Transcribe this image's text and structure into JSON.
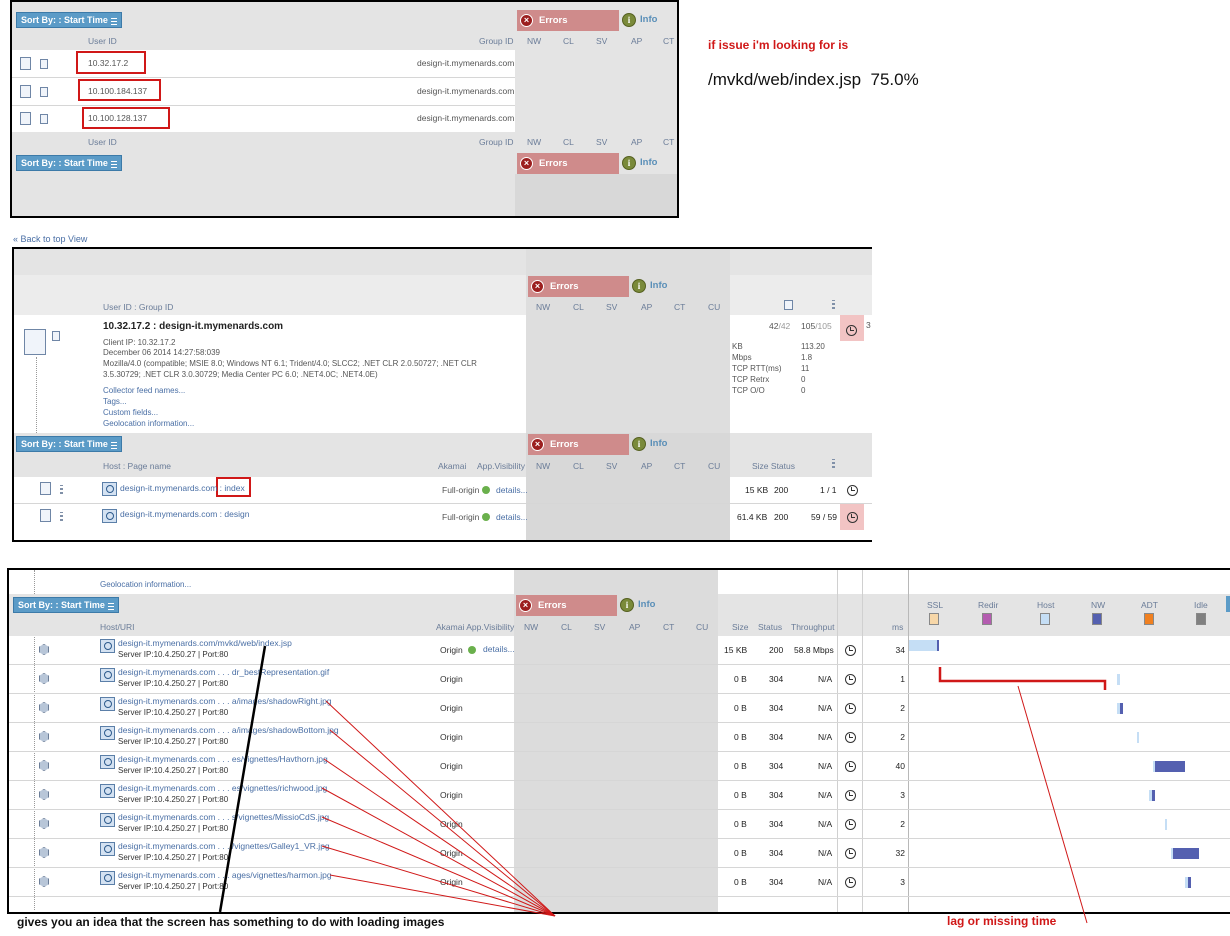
{
  "annotations": {
    "issue_title": "if issue i'm looking for is",
    "issue_value": "/mvkd/web/index.jsp  75.0%",
    "images_note": "gives you an idea that the screen has something to do with loading images",
    "lag_note": "lag or missing time"
  },
  "common": {
    "sort_by": "Sort By: : Start Time",
    "errors": "Errors",
    "info": "Info",
    "nw": "NW",
    "cl": "CL",
    "sv": "SV",
    "ap": "AP",
    "ct": "CT",
    "cu": "CU",
    "back_link": "« Back to top View"
  },
  "panel1": {
    "col_user_id": "User ID",
    "col_group_id": "Group ID",
    "rows": [
      {
        "user_id": "10.32.17.2",
        "group_id": "design-it.mymenards.com"
      },
      {
        "user_id": "10.100.184.137",
        "group_id": "design-it.mymenards.com"
      },
      {
        "user_id": "10.100.128.137",
        "group_id": "design-it.mymenards.com"
      }
    ]
  },
  "panel2": {
    "col_user_group": "User ID : Group ID",
    "title": "10.32.17.2 : design-it.mymenards.com",
    "client_ip": "Client IP: 10.32.17.2",
    "date": "December 06 2014 14:27:58:039",
    "agent1": "Mozilla/4.0 (compatible; MSIE 8.0; Windows NT 6.1; Trident/4.0; SLCC2; .NET CLR 2.0.50727; .NET CLR",
    "agent2": "3.5.30729; .NET CLR 3.0.30729; Media Center PC 6.0; .NET4.0C; .NET4.0E)",
    "links": [
      "Collector feed names...",
      "Tags...",
      "Custom fields...",
      "Geolocation information..."
    ],
    "count1": "42",
    "count1_total": "/42",
    "count2": "105",
    "count2_total": "/105",
    "three": "3",
    "stats": [
      {
        "label": "KB",
        "value": "113.20"
      },
      {
        "label": "Mbps",
        "value": "1.8"
      },
      {
        "label": "TCP RTT(ms)",
        "value": "11"
      },
      {
        "label": "TCP Retrx",
        "value": "0"
      },
      {
        "label": "TCP O/O",
        "value": "0"
      }
    ],
    "col_host_page": "Host : Page name",
    "col_akamai": "Akamai",
    "col_appvis": "App.Visibility",
    "col_size_status": "Size Status",
    "pages": [
      {
        "host": "design-it.mymenards.com",
        "page": " : index",
        "akamai": "Full-origin",
        "details": "details...",
        "size": "15 KB",
        "status": "200",
        "count": "1 / 1"
      },
      {
        "host": "design-it.mymenards.com : design",
        "page": "",
        "akamai": "Full-origin",
        "details": "details...",
        "size": "61.4 KB",
        "status": "200",
        "count": "59 / 59"
      }
    ]
  },
  "panel3": {
    "geo_link": "Geolocation information...",
    "col_host_uri": "Host/URI",
    "col_akamai_vis": "Akamai App.Visibility",
    "col_size": "Size",
    "col_status": "Status",
    "col_throughput": "Throughput",
    "col_ms": "ms",
    "legend": [
      {
        "label": "SSL",
        "color": "#f7d7a8"
      },
      {
        "label": "Redir",
        "color": "#b45cb0"
      },
      {
        "label": "Host",
        "color": "#c5def5"
      },
      {
        "label": "NW",
        "color": "#5460b0"
      },
      {
        "label": "ADT",
        "color": "#f08020"
      },
      {
        "label": "Idle",
        "color": "#808080"
      }
    ],
    "rows": [
      {
        "uri": "design-it.mymenards.com/mvkd/web/index.jsp",
        "server": "Server IP:10.4.250.27 | Port:80",
        "akamai": "Origin",
        "details": "details...",
        "size": "15 KB",
        "status": "200",
        "throughput": "58.8 Mbps",
        "ms": "34"
      },
      {
        "uri": "design-it.mymenards.com . . . dr_bestRepresentation.gif",
        "server": "Server IP:10.4.250.27 | Port:80",
        "akamai": "Origin",
        "details": "",
        "size": "0 B",
        "status": "304",
        "throughput": "N/A",
        "ms": "1"
      },
      {
        "uri": "design-it.mymenards.com . . . a/images/shadowRight.jpg",
        "server": "Server IP:10.4.250.27 | Port:80",
        "akamai": "Origin",
        "details": "",
        "size": "0 B",
        "status": "304",
        "throughput": "N/A",
        "ms": "2"
      },
      {
        "uri": "design-it.mymenards.com . . . a/images/shadowBottom.jpg",
        "server": "Server IP:10.4.250.27 | Port:80",
        "akamai": "Origin",
        "details": "",
        "size": "0 B",
        "status": "304",
        "throughput": "N/A",
        "ms": "2"
      },
      {
        "uri": "design-it.mymenards.com . . . es/vignettes/Havthorn.jpg",
        "server": "Server IP:10.4.250.27 | Port:80",
        "akamai": "Origin",
        "details": "",
        "size": "0 B",
        "status": "304",
        "throughput": "N/A",
        "ms": "40"
      },
      {
        "uri": "design-it.mymenards.com . . . es/vignettes/richwood.jpg",
        "server": "Server IP:10.4.250.27 | Port:80",
        "akamai": "Origin",
        "details": "",
        "size": "0 B",
        "status": "304",
        "throughput": "N/A",
        "ms": "3"
      },
      {
        "uri": "design-it.mymenards.com . . . s/vignettes/MissioCdS.jpg",
        "server": "Server IP:10.4.250.27 | Port:80",
        "akamai": "Origin",
        "details": "",
        "size": "0 B",
        "status": "304",
        "throughput": "N/A",
        "ms": "2"
      },
      {
        "uri": "design-it.mymenards.com . . . /vignettes/Galley1_VR.jpg",
        "server": "Server IP:10.4.250.27 | Port:80",
        "akamai": "Origin",
        "details": "",
        "size": "0 B",
        "status": "304",
        "throughput": "N/A",
        "ms": "32"
      },
      {
        "uri": "design-it.mymenards.com . . . ages/vignettes/harmon.jpg",
        "server": "Server IP:10.4.250.27 | Port:80",
        "akamai": "Origin",
        "details": "",
        "size": "0 B",
        "status": "304",
        "throughput": "N/A",
        "ms": "3"
      }
    ]
  }
}
